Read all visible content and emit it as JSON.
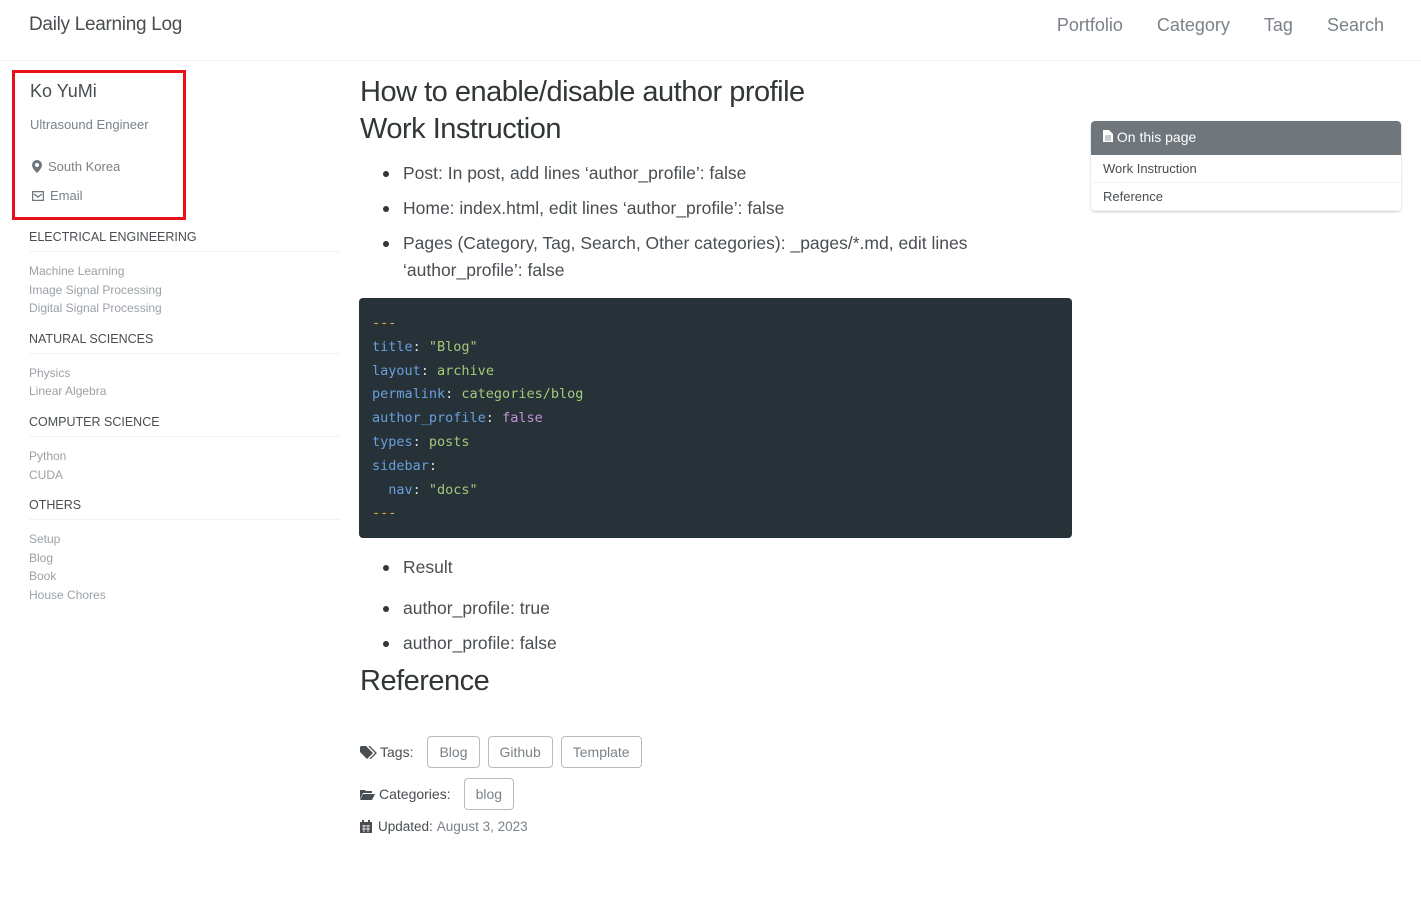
{
  "header": {
    "brand": "Daily Learning Log",
    "nav": [
      "Portfolio",
      "Category",
      "Tag",
      "Search"
    ]
  },
  "author": {
    "name": "Ko YuMi",
    "bio": "Ultrasound Engineer",
    "location": "South Korea",
    "email": "Email"
  },
  "sidebar": [
    {
      "title": "ELECTRICAL ENGINEERING",
      "items": [
        "Machine Learning",
        "Image Signal Processing",
        "Digital Signal Processing"
      ]
    },
    {
      "title": "NATURAL SCIENCES",
      "items": [
        "Physics",
        "Linear Algebra"
      ]
    },
    {
      "title": "COMPUTER SCIENCE",
      "items": [
        "Python",
        "CUDA"
      ]
    },
    {
      "title": "OTHERS",
      "items": [
        "Setup",
        "Blog",
        "Book",
        "House Chores"
      ]
    }
  ],
  "main": {
    "title": "How to enable/disable author profile",
    "section1": "Work Instruction",
    "bullets": [
      "Post: In post, add lines ‘author_profile’: false",
      "Home: index.html, edit lines ‘author_profile’: false",
      "Pages (Category, Tag, Search, Other categories): _pages/*.md, edit lines ‘author_profile’: false"
    ],
    "code": {
      "dash": "---",
      "title_k": "title",
      "title_v": "\"Blog\"",
      "layout_k": "layout",
      "layout_v": "archive",
      "permalink_k": "permalink",
      "permalink_v": "categories/blog",
      "ap_k": "author_profile",
      "ap_v": "false",
      "types_k": "types",
      "types_v": "posts",
      "sidebar_k": "sidebar",
      "nav_k": "nav",
      "nav_v": "\"docs\""
    },
    "result": "Result",
    "results": [
      "author_profile: true",
      "author_profile: false"
    ],
    "section2": "Reference",
    "tags_label": "Tags:",
    "tags": [
      "Blog",
      "Github",
      "Template"
    ],
    "categories_label": "Categories:",
    "categories": [
      "blog"
    ],
    "updated_label": "Updated:",
    "updated": "August 3, 2023"
  },
  "toc": {
    "title": "On this page",
    "items": [
      "Work Instruction",
      "Reference"
    ]
  }
}
